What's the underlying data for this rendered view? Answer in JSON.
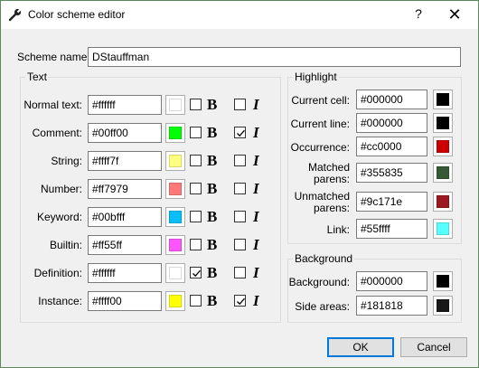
{
  "window": {
    "title": "Color scheme editor",
    "help": "?",
    "close": "✕"
  },
  "scheme": {
    "label": "Scheme name:",
    "value": "DStauffman"
  },
  "text_group": {
    "title": "Text",
    "rows": [
      {
        "label": "Normal text:",
        "value": "#ffffff",
        "color": "#ffffff",
        "bold": false,
        "italic": false
      },
      {
        "label": "Comment:",
        "value": "#00ff00",
        "color": "#00ff00",
        "bold": false,
        "italic": true
      },
      {
        "label": "String:",
        "value": "#ffff7f",
        "color": "#ffff7f",
        "bold": false,
        "italic": false
      },
      {
        "label": "Number:",
        "value": "#ff7979",
        "color": "#ff7979",
        "bold": false,
        "italic": false
      },
      {
        "label": "Keyword:",
        "value": "#00bfff",
        "color": "#00bfff",
        "bold": false,
        "italic": false
      },
      {
        "label": "Builtin:",
        "value": "#ff55ff",
        "color": "#ff55ff",
        "bold": false,
        "italic": false
      },
      {
        "label": "Definition:",
        "value": "#ffffff",
        "color": "#ffffff",
        "bold": true,
        "italic": false
      },
      {
        "label": "Instance:",
        "value": "#ffff00",
        "color": "#ffff00",
        "bold": false,
        "italic": true
      }
    ],
    "bold_glyph": "B",
    "italic_glyph": "I"
  },
  "highlight_group": {
    "title": "Highlight",
    "rows": [
      {
        "label": "Current cell:",
        "value": "#000000",
        "color": "#000000"
      },
      {
        "label": "Current line:",
        "value": "#000000",
        "color": "#000000"
      },
      {
        "label": "Occurrence:",
        "value": "#cc0000",
        "color": "#cc0000"
      },
      {
        "label_line1": "Matched",
        "label_line2": "parens:",
        "value": "#355835",
        "color": "#355835"
      },
      {
        "label_line1": "Unmatched",
        "label_line2": "parens:",
        "value": "#9c171e",
        "color": "#9c171e"
      },
      {
        "label": "Link:",
        "value": "#55ffff",
        "color": "#55ffff"
      }
    ]
  },
  "background_group": {
    "title": "Background",
    "rows": [
      {
        "label": "Background:",
        "value": "#000000",
        "color": "#000000"
      },
      {
        "label": "Side areas:",
        "value": "#181818",
        "color": "#181818"
      }
    ]
  },
  "buttons": {
    "ok": "OK",
    "cancel": "Cancel"
  }
}
